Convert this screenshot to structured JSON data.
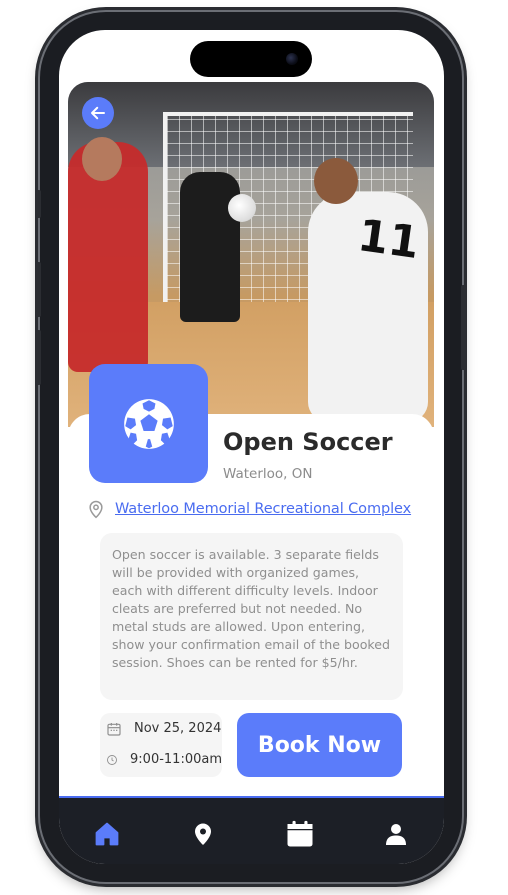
{
  "event": {
    "title": "Open Soccer",
    "city": "Waterloo, ON",
    "venue": "Waterloo Memorial Recreational Complex",
    "description": "Open soccer is available. 3 separate fields will be provided with organized games, each with different difficulty levels. Indoor cleats are preferred but not needed. No metal studs are allowed. Upon entering, show your confirmation email of the booked session. Shoes can be rented for $5/hr.",
    "date": "Nov 25, 2024",
    "time": "9:00-11:00am",
    "book_label": "Book Now"
  },
  "icons": {
    "back": "arrow-left-icon",
    "sport": "soccer-ball-icon",
    "location": "map-pin-icon",
    "calendar": "calendar-icon",
    "clock": "clock-icon"
  },
  "nav": {
    "items": [
      "home-icon",
      "location-icon",
      "calendar-icon",
      "profile-icon"
    ],
    "active": "home-icon"
  },
  "colors": {
    "accent": "#5b7cfa",
    "link": "#4a6cf0",
    "nav_bg": "#1c1f26",
    "nav_active": "#5b7cfa",
    "nav_inactive": "#ffffff"
  }
}
